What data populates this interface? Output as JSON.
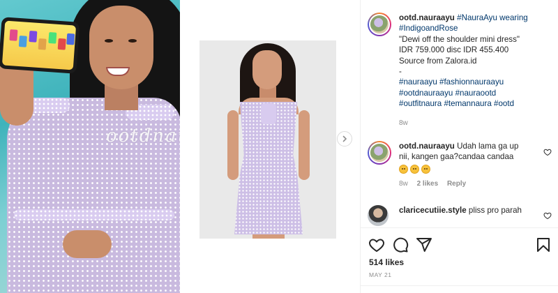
{
  "media": {
    "watermark": "ootdnauraayu"
  },
  "caption": {
    "username": "ootd.nauraayu",
    "lines": [
      "#NauraAyu wearing",
      "#IndigoandRose",
      "\"Dewi off the shoulder mini dress\"",
      "IDR 759.000 disc IDR 455.400",
      "Source from Zalora.id",
      "-",
      "#nauraayu #fashionnauraayu",
      "#ootdnauraayu #nauraootd",
      "#outfitnaura #temannaura #ootd"
    ],
    "time": "8w"
  },
  "comments": [
    {
      "username": "ootd.nauraayu",
      "text_line1": "Udah lama ga up",
      "text_line2": "nii, kangen gaa?candaa candaa",
      "time": "8w",
      "likes": "2 likes",
      "reply": "Reply"
    },
    {
      "username": "claricecutiie.style",
      "text": "pliss pro parah"
    }
  ],
  "actions": {
    "likes": "514 likes",
    "date": "MAY 21"
  },
  "colors": {
    "link": "#00376b",
    "muted": "#8e8e8e",
    "text": "#262626"
  }
}
